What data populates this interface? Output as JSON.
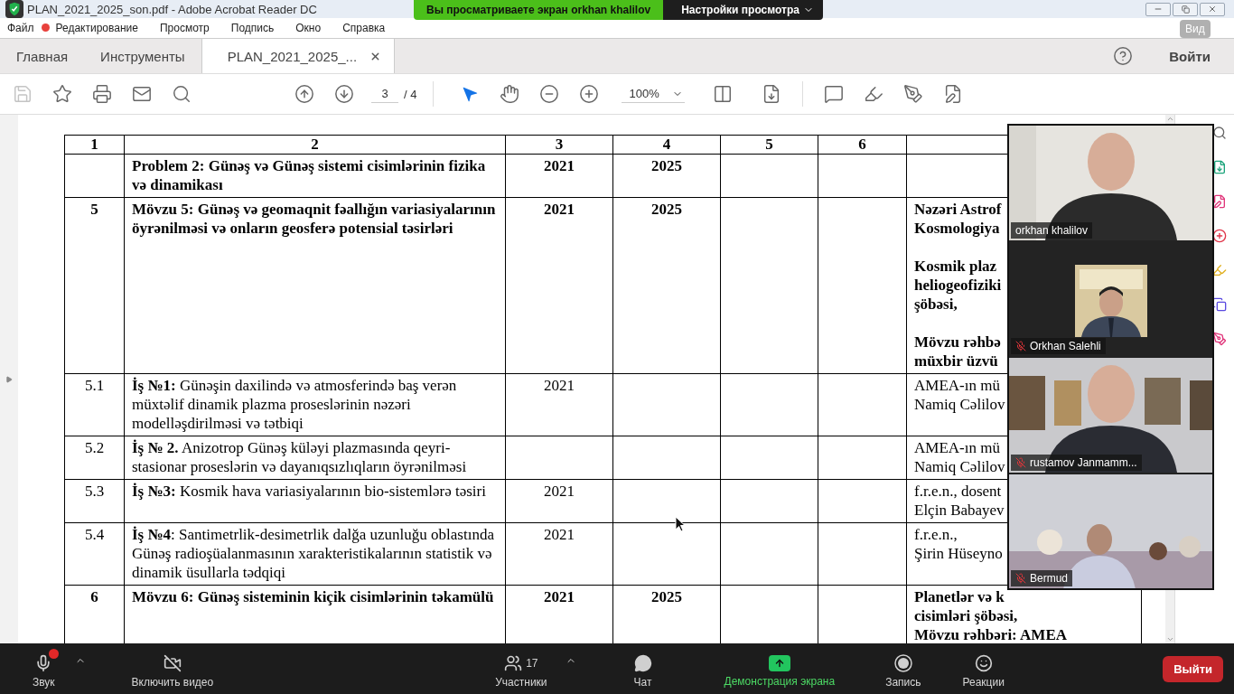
{
  "window": {
    "title": "PLAN_2021_2025_son.pdf - Adobe Acrobat Reader DC"
  },
  "share_banner": {
    "text": "Вы просматриваете экран orkhan khalilov",
    "settings": "Настройки просмотра"
  },
  "view_button": "Вид",
  "menu": [
    "Файл",
    "Редактирование",
    "Просмотр",
    "Подпись",
    "Окно",
    "Справка"
  ],
  "tabs": [
    {
      "label": "Главная",
      "selected": false,
      "closable": false
    },
    {
      "label": "Инструменты",
      "selected": false,
      "closable": false
    },
    {
      "label": "PLAN_2021_2025_...",
      "selected": true,
      "closable": true
    }
  ],
  "sign_in": "Войти",
  "toolbar": {
    "page": "3",
    "pages": "/ 4",
    "zoom": "100%",
    "left_tools": [
      {
        "kind": "save",
        "disabled": true,
        "selected": false
      },
      {
        "kind": "star",
        "disabled": false,
        "selected": false
      },
      {
        "kind": "print",
        "disabled": false,
        "selected": false
      },
      {
        "kind": "mail",
        "disabled": false,
        "selected": false
      },
      {
        "kind": "find",
        "disabled": false,
        "selected": false
      }
    ],
    "nav_tools": [
      {
        "kind": "up",
        "disabled": false,
        "selected": false
      },
      {
        "kind": "down",
        "disabled": false,
        "selected": false
      }
    ],
    "view_tools": [
      {
        "kind": "select",
        "disabled": false,
        "selected": true
      },
      {
        "kind": "hand",
        "disabled": false,
        "selected": false
      },
      {
        "kind": "zoom_out",
        "disabled": false,
        "selected": false
      },
      {
        "kind": "zoom_in",
        "disabled": false,
        "selected": false
      }
    ],
    "right_tools": [
      {
        "kind": "comment",
        "disabled": false,
        "selected": false
      },
      {
        "kind": "highlight",
        "disabled": false,
        "selected": false
      },
      {
        "kind": "sign",
        "disabled": false,
        "selected": false
      },
      {
        "kind": "edit",
        "disabled": false,
        "selected": false
      }
    ]
  },
  "table": {
    "header": [
      "1",
      "2",
      "3",
      "4",
      "5",
      "6"
    ],
    "rows": [
      {
        "heading": true,
        "title": "Problem 2: Günəş və Günəş sistemi cisimlərinin fizika və dinamikası",
        "start": "2021",
        "end": "2025"
      },
      {
        "heading": true,
        "number": "5",
        "title": "Mövzu 5: Günəş və geomaqnit fəallığın variasiyalarının öyrənilməsi və onların geosferə potensial təsirləri",
        "start": "2021",
        "end": "2025",
        "responsible": [
          [
            "Nəzəri Astrof",
            "Kosmologiya"
          ],
          [
            "Kosmik plaz",
            "heliogeofiziki",
            "şöbəsi,"
          ],
          [
            "Mövzu rəhbə",
            "müxbir üzvü"
          ]
        ]
      },
      {
        "heading": false,
        "number": "5.1",
        "title": "**İş №1:** Günəşin daxilində və atmosferində baş verən müxtəlif dinamik plazma proseslərinin nəzəri modelləşdirilməsi və tətbiqi",
        "start": "2021",
        "responsible": [
          [
            "AMEA-ın mü",
            "Namiq Cəlilov"
          ]
        ]
      },
      {
        "heading": false,
        "number": "5.2",
        "title": "**İş № 2.** Anizotrop Günəş küləyi plazmasında qeyri-stasionar proseslərin və dayanıqsızlıqların öyrənilməsi",
        "responsible": [
          [
            "AMEA-ın mü",
            "Namiq Cəlilov"
          ]
        ]
      },
      {
        "heading": false,
        "number": "5.3",
        "title": "**İş №3:** Kosmik hava variasiyalarının bio-sistemlərə təsiri",
        "start": "2021",
        "responsible": [
          [
            "f.r.e.n., dosent",
            "Elçin Babayev"
          ]
        ]
      },
      {
        "heading": false,
        "number": "5.4",
        "title": "**İş №4**: Santimetrlik-desimetrlik dalğa uzunluğu oblastında Günəş radioşüalanmasının xarakteristikalarının statistik və dinamik üsullarla tədqiqi",
        "start": "2021",
        "responsible": [
          [
            "f.r.e.n.,",
            "Şirin Hüseyno"
          ]
        ]
      },
      {
        "heading": true,
        "number": "6",
        "title": "Mövzu 6: Günəş sisteminin kiçik cisimlərinin təkamülü",
        "start": "2021",
        "end": "2025",
        "responsible": [
          [
            "Planetlər və k",
            "cisimləri şöbəsi,",
            "Mövzu rəhbəri: AMEA"
          ]
        ]
      }
    ]
  },
  "participants": [
    {
      "name": "orkhan khalilov",
      "muted": false,
      "kind": "camera"
    },
    {
      "name": "Orkhan Salehli",
      "muted": true
    },
    {
      "name": "rustamov Janmamm...",
      "muted": true,
      "kind": "camera"
    },
    {
      "name": "Bermud",
      "muted": true,
      "kind": "camera"
    }
  ],
  "meeting_bar": {
    "left": [
      {
        "kind": "audio",
        "label": "Звук",
        "alert": true
      },
      {
        "kind": "video",
        "label": "Включить видео",
        "alert": false
      }
    ],
    "center": [
      {
        "kind": "participants",
        "label": "Участники",
        "count": "17",
        "active": false
      },
      {
        "kind": "chat",
        "label": "Чат",
        "active": false
      },
      {
        "kind": "share",
        "label": "Демонстрация экрана",
        "active": true
      },
      {
        "kind": "record",
        "label": "Запись",
        "active": false
      },
      {
        "kind": "reactions",
        "label": "Реакции",
        "active": false
      }
    ],
    "leave": "Выйти"
  }
}
